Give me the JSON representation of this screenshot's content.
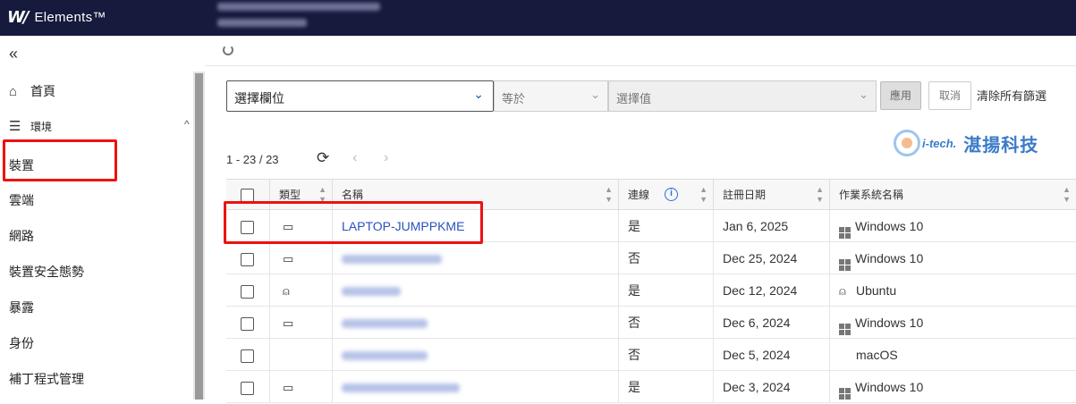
{
  "topbar": {
    "logo_mark": "W/",
    "app_name": "Elements™"
  },
  "sidebar": {
    "collapse_icon": "«",
    "items": [
      {
        "label": "首頁",
        "icon": "home-icon"
      },
      {
        "label": "環境",
        "icon": "list-icon"
      },
      {
        "label": "裝置"
      },
      {
        "label": "雲端"
      },
      {
        "label": "網路"
      },
      {
        "label": "裝置安全態勢"
      },
      {
        "label": "暴露"
      },
      {
        "label": "身份"
      },
      {
        "label": "補丁程式管理"
      }
    ]
  },
  "filter": {
    "field_label": "選擇欄位",
    "operator_label": "等於",
    "value_placeholder": "選擇值",
    "apply_label": "應用",
    "cancel_label": "取消",
    "clear_label": "清除所有篩選"
  },
  "watermark": {
    "tech": "i-tech.",
    "name": "湛揚科技"
  },
  "pager": {
    "count": "1 - 23 / 23"
  },
  "table": {
    "headers": {
      "type": "類型",
      "name": "名稱",
      "online": "連線",
      "registered": "註冊日期",
      "os": "作業系統名稱"
    },
    "rows": [
      {
        "type": "desktop-icon",
        "name": "LAPTOP-JUMPPKME",
        "online": "是",
        "registered": "Jan 6, 2025",
        "os": "Windows 10",
        "os_icon": "windows-icon"
      },
      {
        "type": "desktop-icon",
        "name": "",
        "online": "否",
        "registered": "Dec 25, 2024",
        "os": "Windows 10",
        "os_icon": "windows-icon"
      },
      {
        "type": "linux-icon",
        "name": "",
        "online": "是",
        "registered": "Dec 12, 2024",
        "os": "Ubuntu",
        "os_icon": "linux-icon"
      },
      {
        "type": "desktop-icon",
        "name": "",
        "online": "否",
        "registered": "Dec 6, 2024",
        "os": "Windows 10",
        "os_icon": "windows-icon"
      },
      {
        "type": "apple-icon",
        "name": "",
        "online": "否",
        "registered": "Dec 5, 2024",
        "os": "macOS",
        "os_icon": "apple-icon"
      },
      {
        "type": "desktop-icon",
        "name": "",
        "online": "是",
        "registered": "Dec 3, 2024",
        "os": "Windows 10",
        "os_icon": "windows-icon"
      }
    ]
  },
  "colors": {
    "topbar": "#161a3c",
    "link": "#2a52be",
    "highlight": "#ee1111"
  }
}
